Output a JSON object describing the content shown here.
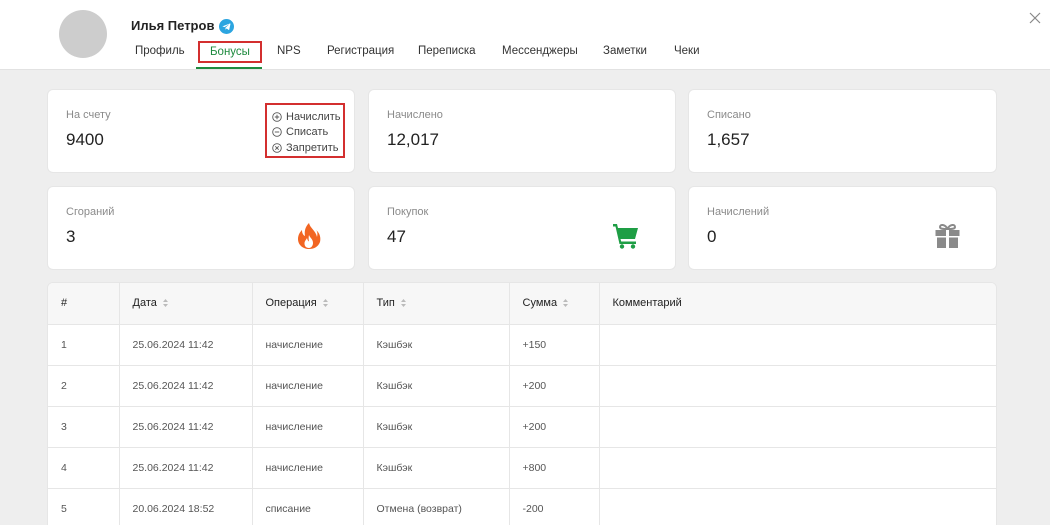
{
  "user": {
    "name": "Илья Петров"
  },
  "tabs": [
    {
      "label": "Профиль"
    },
    {
      "label": "Бонусы"
    },
    {
      "label": "NPS"
    },
    {
      "label": "Регистрация"
    },
    {
      "label": "Переписка"
    },
    {
      "label": "Мессенджеры"
    },
    {
      "label": "Заметки"
    },
    {
      "label": "Чеки"
    }
  ],
  "active_tab": "Бонусы",
  "cards": {
    "balance": {
      "label": "На счету",
      "value": "9400"
    },
    "accrued": {
      "label": "Начислено",
      "value": "12,017"
    },
    "written_off": {
      "label": "Списано",
      "value": "1,657"
    },
    "burned": {
      "label": "Сгораний",
      "value": "3",
      "icon": "fire-icon"
    },
    "purchases": {
      "label": "Покупок",
      "value": "47",
      "icon": "cart-icon"
    },
    "accruals": {
      "label": "Начислений",
      "value": "0",
      "icon": "gift-icon"
    }
  },
  "actions": {
    "accrue": "Начислить",
    "write_off": "Списать",
    "forbid": "Запретить"
  },
  "table": {
    "headers": [
      "#",
      "Дата",
      "Операция",
      "Тип",
      "Сумма",
      "Комментарий"
    ],
    "rows": [
      [
        "1",
        "25.06.2024 11:42",
        "начисление",
        "Кэшбэк",
        "+150",
        ""
      ],
      [
        "2",
        "25.06.2024 11:42",
        "начисление",
        "Кэшбэк",
        "+200",
        ""
      ],
      [
        "3",
        "25.06.2024 11:42",
        "начисление",
        "Кэшбэк",
        "+200",
        ""
      ],
      [
        "4",
        "25.06.2024 11:42",
        "начисление",
        "Кэшбэк",
        "+800",
        ""
      ],
      [
        "5",
        "20.06.2024 18:52",
        "списание",
        "Отмена (возврат)",
        "-200",
        ""
      ]
    ]
  },
  "colors": {
    "accent": "#1e8a3e",
    "highlight": "#d32f2f",
    "fire": "#f26522",
    "telegram": "#2ca5e0"
  }
}
